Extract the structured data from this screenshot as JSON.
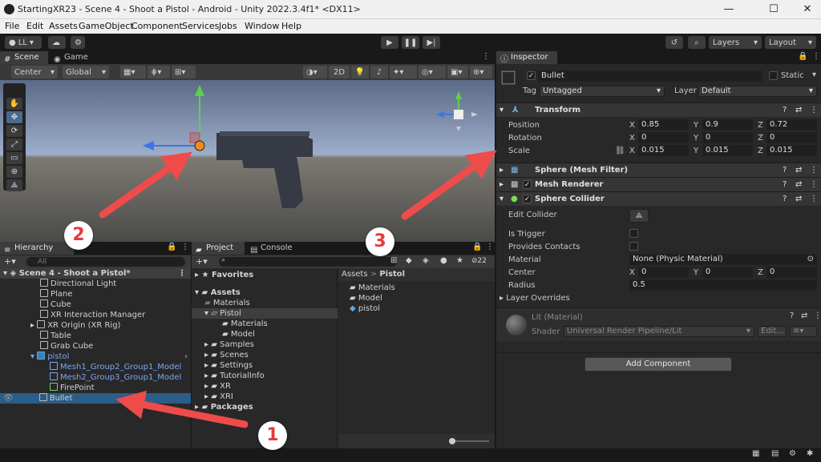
{
  "window": {
    "title": "StartingXR23 - Scene 4 - Shoot a Pistol - Android - Unity 2022.3.4f1* <DX11>",
    "minimize": "—",
    "maximize": "☐",
    "close": "✕"
  },
  "menu": [
    "File",
    "Edit",
    "Assets",
    "GameObject",
    "Component",
    "Services",
    "Jobs",
    "Window",
    "Help"
  ],
  "toolbar": {
    "account": "LL",
    "layers": "Layers",
    "layout": "Layout"
  },
  "scene_tabs": {
    "scene": "Scene",
    "game": "Game"
  },
  "scene_toolbar": {
    "pivot": "Center",
    "space": "Global",
    "mode2d": "2D"
  },
  "hierarchy": {
    "tab": "Hierarchy",
    "search_placeholder": "All",
    "scene_name": "Scene 4 - Shoot a Pistol*",
    "items": [
      {
        "label": "Directional Light"
      },
      {
        "label": "Plane"
      },
      {
        "label": "Cube"
      },
      {
        "label": "XR Interaction Manager"
      },
      {
        "label": "XR Origin (XR Rig)"
      },
      {
        "label": "Table"
      },
      {
        "label": "Grab Cube"
      },
      {
        "label": "pistol"
      },
      {
        "label": "Mesh1_Group2_Group1_Model"
      },
      {
        "label": "Mesh2_Group3_Group1_Model"
      },
      {
        "label": "FirePoint"
      },
      {
        "label": "Bullet"
      }
    ]
  },
  "project": {
    "tab_project": "Project",
    "tab_console": "Console",
    "hidden_count": "22",
    "favorites": "Favorites",
    "tree": [
      "Assets",
      "Materials",
      "Pistol",
      "Materials",
      "Model",
      "Samples",
      "Scenes",
      "Settings",
      "TutorialInfo",
      "XR",
      "XRI",
      "Packages"
    ],
    "breadcrumb_root": "Assets",
    "breadcrumb_sep": ">",
    "breadcrumb_current": "Pistol",
    "files": [
      "Materials",
      "Model",
      "pistol"
    ]
  },
  "inspector": {
    "tab": "Inspector",
    "object_name": "Bullet",
    "static_label": "Static",
    "tag_label": "Tag",
    "tag_value": "Untagged",
    "layer_label": "Layer",
    "layer_value": "Default",
    "transform": {
      "title": "Transform",
      "position_label": "Position",
      "position": {
        "x": "0.85",
        "y": "0.9",
        "z": "0.72"
      },
      "rotation_label": "Rotation",
      "rotation": {
        "x": "0",
        "y": "0",
        "z": "0"
      },
      "scale_label": "Scale",
      "scale": {
        "x": "0.015",
        "y": "0.015",
        "z": "0.015"
      }
    },
    "axis": {
      "x": "X",
      "y": "Y",
      "z": "Z"
    },
    "mesh_filter": "Sphere (Mesh Filter)",
    "mesh_renderer": "Mesh Renderer",
    "sphere_collider": {
      "title": "Sphere Collider",
      "edit_collider": "Edit Collider",
      "is_trigger": "Is Trigger",
      "provides_contacts": "Provides Contacts",
      "material_label": "Material",
      "material_value": "None (Physic Material)",
      "center_label": "Center",
      "center": {
        "x": "0",
        "y": "0",
        "z": "0"
      },
      "radius_label": "Radius",
      "radius": "0.5",
      "layer_overrides": "Layer Overrides"
    },
    "material": {
      "name": "Lit (Material)",
      "shader_label": "Shader",
      "shader_value": "Universal Render Pipeline/Lit",
      "edit": "Edit..."
    },
    "add_component": "Add Component"
  },
  "annotations": {
    "one": "1",
    "two": "2",
    "three": "3"
  },
  "colors": {
    "accent_selection": "#2c5d87",
    "arrow": "#ee4b4b",
    "blue_text": "#7ea5f5"
  }
}
